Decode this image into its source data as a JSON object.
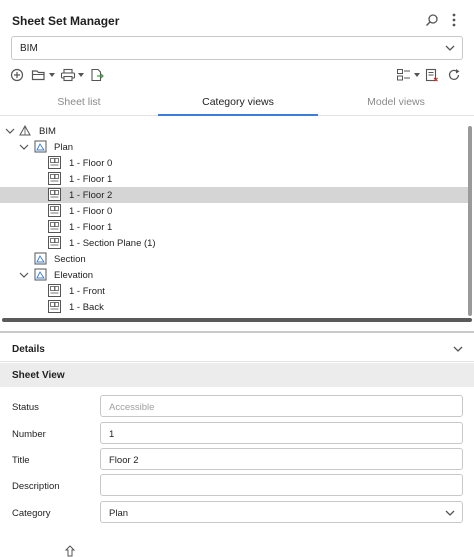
{
  "window": {
    "title": "Sheet Set Manager",
    "search_icon": "search-icon",
    "more_icon": "more-vertical-icon"
  },
  "sheet_set_select": {
    "value": "BIM"
  },
  "toolbar": {
    "icons": [
      "add-circle-icon",
      "open-folder-icon",
      "print-icon",
      "publish-icon",
      "view-options-icon",
      "checklist-icon",
      "refresh-icon"
    ]
  },
  "tabs": [
    {
      "label": "Sheet list",
      "active": false
    },
    {
      "label": "Category views",
      "active": true
    },
    {
      "label": "Model views",
      "active": false
    }
  ],
  "tree": {
    "root": "BIM",
    "nodes": [
      {
        "label": "Plan",
        "type": "category",
        "expanded": true
      },
      {
        "label": "1 - Floor 0",
        "type": "view"
      },
      {
        "label": "1 - Floor 1",
        "type": "view"
      },
      {
        "label": "1 - Floor 2",
        "type": "view",
        "selected": true
      },
      {
        "label": "1 - Floor 0",
        "type": "view"
      },
      {
        "label": "1 - Floor 1",
        "type": "view"
      },
      {
        "label": "1 - Section Plane (1)",
        "type": "view"
      },
      {
        "label": "Section",
        "type": "category",
        "expanded": false
      },
      {
        "label": "Elevation",
        "type": "category",
        "expanded": true
      },
      {
        "label": "1 - Front",
        "type": "view"
      },
      {
        "label": "1 - Back",
        "type": "view"
      }
    ]
  },
  "details": {
    "header": "Details",
    "section_title": "Sheet View",
    "fields": {
      "status": {
        "label": "Status",
        "placeholder": "Accessible",
        "value": ""
      },
      "number": {
        "label": "Number",
        "value": "1"
      },
      "title": {
        "label": "Title",
        "value": "Floor 2"
      },
      "description": {
        "label": "Description",
        "value": ""
      },
      "category": {
        "label": "Category",
        "value": "Plan"
      }
    }
  },
  "colors": {
    "accent": "#3b7ddd",
    "selected_row": "#d5d5d5",
    "section_bg": "#ececec"
  }
}
